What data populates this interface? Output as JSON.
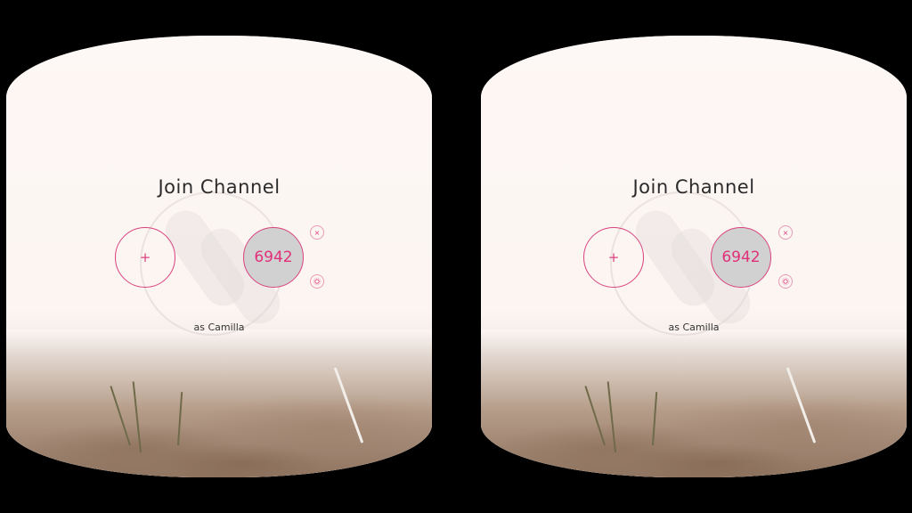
{
  "title": "Join Channel",
  "add_label": "+",
  "channel_code": "6942",
  "close_label": "×",
  "settings_icon": "settings-gear-icon",
  "as_user": "as Camilla",
  "colors": {
    "accent": "#d9427e",
    "sky": "#fcf6f4",
    "sand": "#a48a76"
  }
}
